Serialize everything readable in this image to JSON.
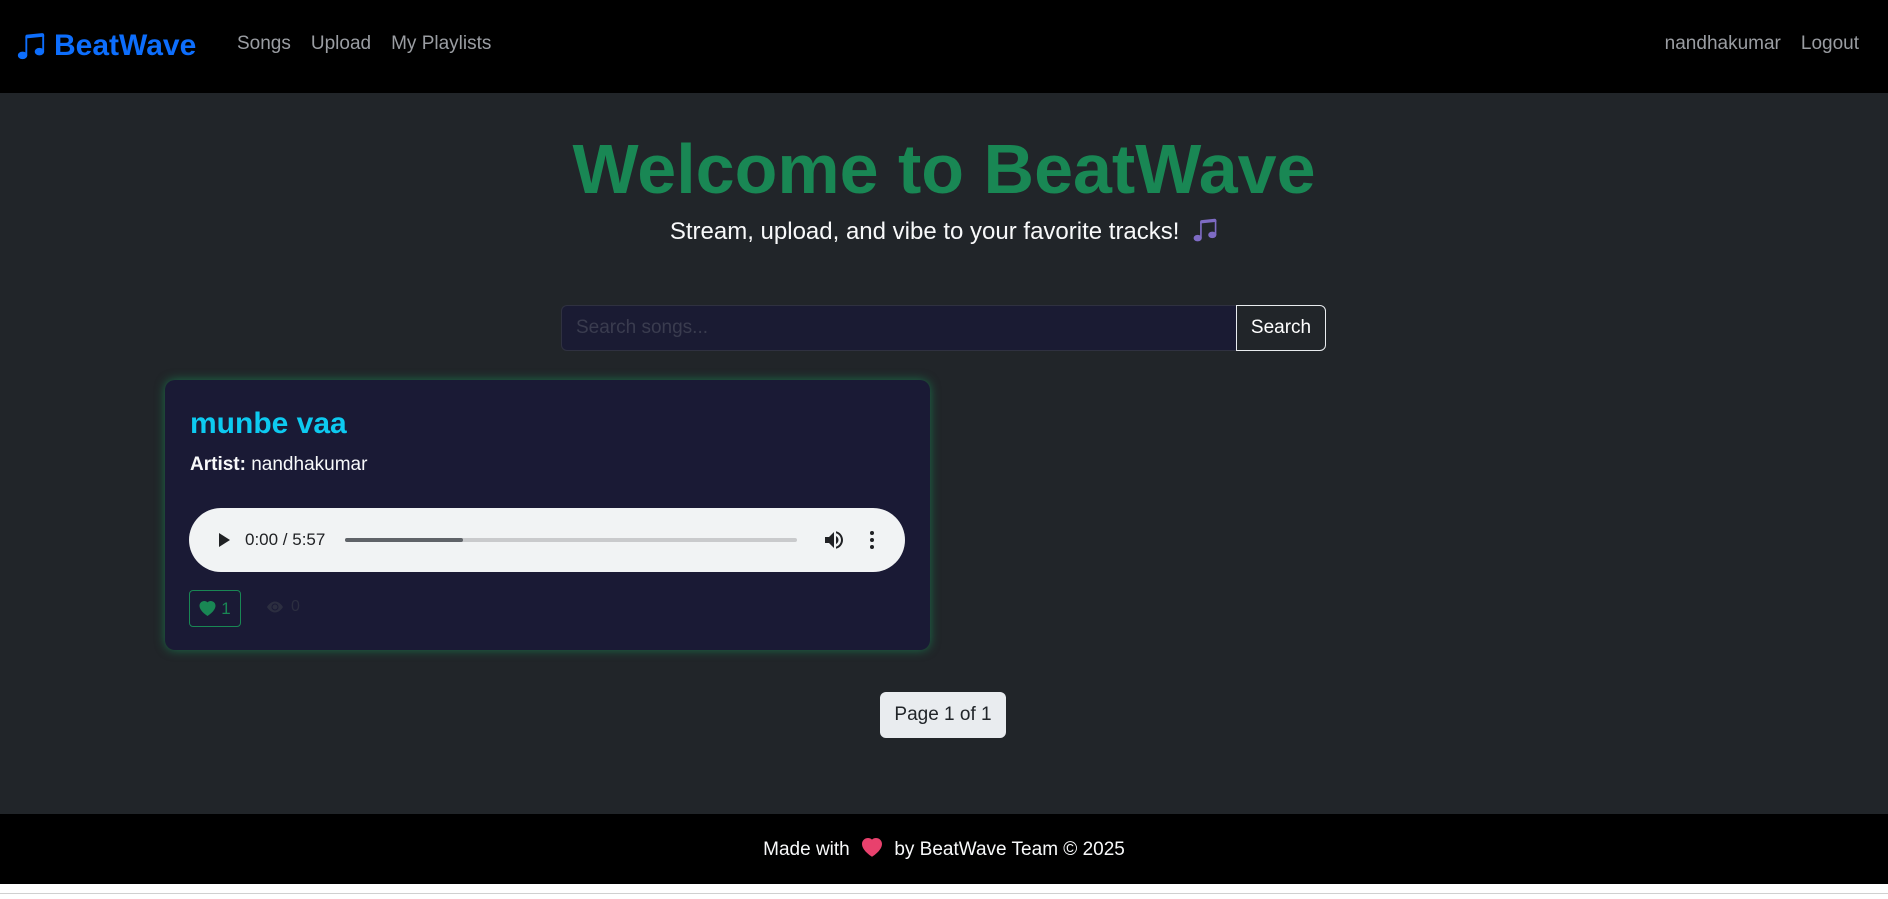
{
  "navbar": {
    "brand": "BeatWave",
    "links": [
      "Songs",
      "Upload",
      "My Playlists"
    ],
    "user": "nandhakumar",
    "logout": "Logout"
  },
  "hero": {
    "title": "Welcome to BeatWave",
    "subtitle": "Stream, upload, and vibe to your favorite tracks!"
  },
  "search": {
    "placeholder": "Search songs...",
    "value": "",
    "button": "Search"
  },
  "songs": [
    {
      "title": "munbe vaa",
      "artist_label": "Artist:",
      "artist": "nandhakumar",
      "audio": {
        "time": "0:00 / 5:57",
        "progress": 0.26
      },
      "likes": "1",
      "views": "0"
    }
  ],
  "pagination": {
    "text": "Page 1 of 1"
  },
  "footer": {
    "prefix": "Made with",
    "suffix": "by BeatWave Team © 2025"
  },
  "colors": {
    "brand": "#0d6efd",
    "hero_title": "#198754",
    "song_title": "#0dcaf0",
    "like": "#198754",
    "card_bg": "#1a1a35",
    "page_bg": "#212529",
    "heart": "#e8416d"
  },
  "icons": {
    "brand": "music-note-icon",
    "subtitle": "music-notes-icon",
    "like": "heart-icon",
    "views": "eye-icon",
    "footer": "heart-icon"
  }
}
